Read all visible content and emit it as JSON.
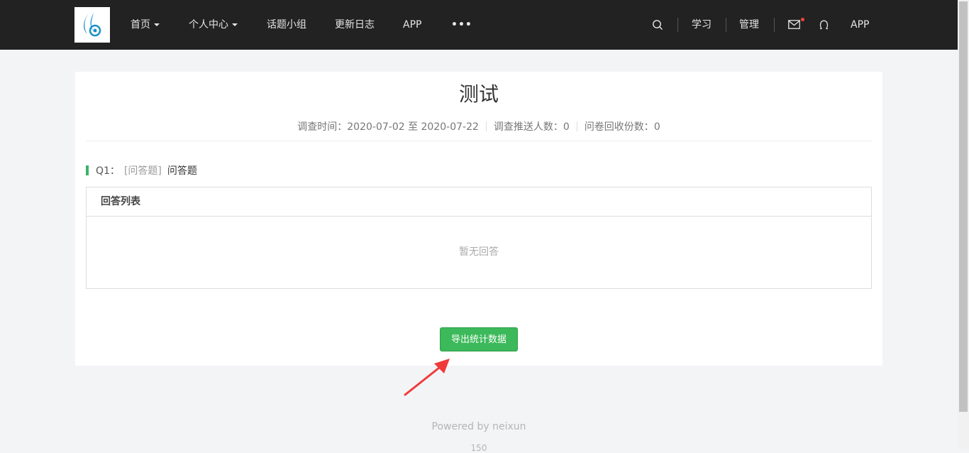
{
  "nav": {
    "items": [
      {
        "label": "首页",
        "has_caret": true
      },
      {
        "label": "个人中心",
        "has_caret": true
      },
      {
        "label": "话题小组",
        "has_caret": false
      },
      {
        "label": "更新日志",
        "has_caret": false
      },
      {
        "label": "APP",
        "has_caret": false
      }
    ],
    "more_icon": "more-dots-icon",
    "right": {
      "search_icon": "search-icon",
      "study": "学习",
      "manage": "管理",
      "mail_icon": "mail-icon",
      "mail_has_unread": true,
      "user_icon": "user-icon",
      "app": "APP"
    }
  },
  "survey": {
    "title": "测试",
    "meta": {
      "time_label": "调查时间：",
      "time_value": "2020-07-02 至 2020-07-22",
      "push_label": "调查推送人数：",
      "push_value": "0",
      "collect_label": "问卷回收份数：",
      "collect_value": "0"
    },
    "questions": [
      {
        "number": "Q1：",
        "type": "[问答题]",
        "text": "问答题",
        "answers_header": "回答列表",
        "empty_text": "暂无回答"
      }
    ],
    "export_button": "导出统计数据"
  },
  "footer": {
    "powered_by": "Powered by neixun",
    "sub_text": "150"
  },
  "colors": {
    "topbar": "#222222",
    "accent_green": "#3cb95a",
    "question_marker": "#3bb26a",
    "annotation_arrow": "#f03a3a",
    "unread_dot": "#f44336"
  }
}
